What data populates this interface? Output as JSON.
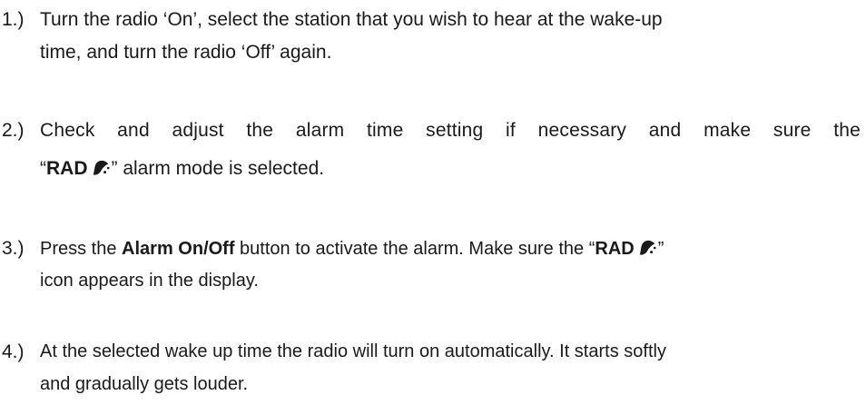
{
  "steps": [
    {
      "number": "1.)",
      "line1": "Turn the radio ‘On’, select the station that you wish to hear at the wake-up",
      "line2": "time, and turn the radio ‘Off’ again."
    },
    {
      "number": "2.)",
      "line1": "Check and adjust the alarm time setting if necessary and make sure the",
      "line2_open_quote": "“",
      "line2_mode": "RAD",
      "line2_close": "” alarm mode is selected."
    },
    {
      "number": "3.)",
      "line1_pre": "Press the ",
      "line1_button": "Alarm On/Off",
      "line1_mid": " button to activate the alarm. Make sure the “",
      "line1_mode": "RAD",
      "line1_close": "”",
      "line2": "icon appears in the display."
    },
    {
      "number": "4.)",
      "line1": "At the selected wake up time the radio will turn on automatically. It starts softly",
      "line2": "and gradually gets louder."
    }
  ],
  "icons": {
    "alarm_bell": "bell-alarm-icon"
  }
}
